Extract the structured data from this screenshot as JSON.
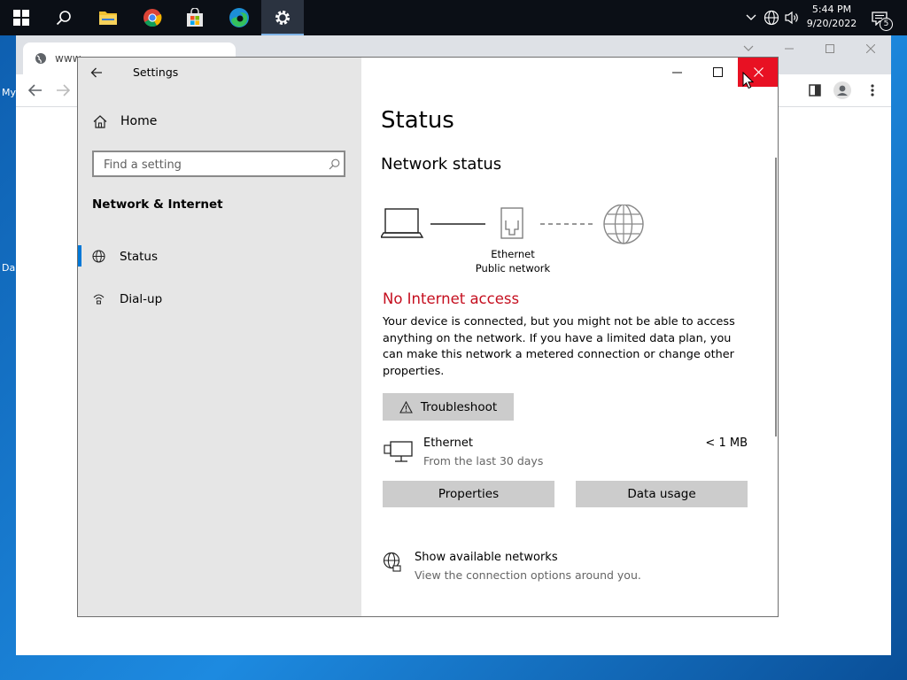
{
  "taskbar": {
    "clock": {
      "time": "5:44 PM",
      "date": "9/20/2022"
    },
    "notification_count": "5"
  },
  "desktop": {
    "frag1": "My",
    "frag2": "Da"
  },
  "browser": {
    "tab_title": "www"
  },
  "settings": {
    "title": "Settings",
    "sidebar": {
      "home_label": "Home",
      "search_placeholder": "Find a setting",
      "section_title": "Network & Internet",
      "items": [
        {
          "label": "Status",
          "icon": "globe-status-icon",
          "selected": true
        },
        {
          "label": "Dial-up",
          "icon": "dial-up-icon",
          "selected": false
        }
      ]
    },
    "main": {
      "heading": "Status",
      "network_status_heading": "Network status",
      "diagram": {
        "adapter_name": "Ethernet",
        "network_type": "Public network"
      },
      "no_internet": "No Internet access",
      "description": "Your device is connected, but you might not be able to access anything on the network. If you have a limited data plan, you can make this network a metered connection or change other properties.",
      "troubleshoot_label": "Troubleshoot",
      "connection": {
        "name": "Ethernet",
        "subtitle": "From the last 30 days",
        "usage": "< 1 MB"
      },
      "properties_label": "Properties",
      "data_usage_label": "Data usage",
      "show_networks": {
        "title": "Show available networks",
        "subtitle": "View the connection options around you."
      }
    }
  },
  "colors": {
    "accent": "#0078d7",
    "error": "#c50f1f",
    "close_hover": "#e81123",
    "sidebar_bg": "#e6e6e6",
    "button_bg": "#cccccc"
  }
}
